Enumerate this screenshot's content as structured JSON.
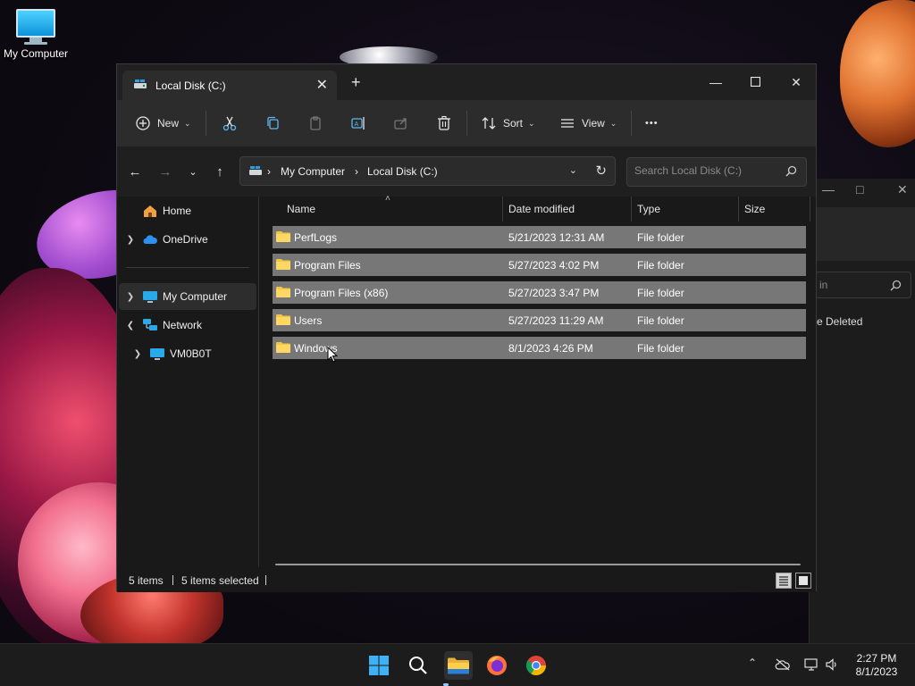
{
  "desktop": {
    "icon_label": "My Computer"
  },
  "background_window": {
    "search_placeholder": "in",
    "deleted_text": "e Deleted"
  },
  "window": {
    "tab_title": "Local Disk (C:)",
    "toolbar": {
      "new_label": "New",
      "sort_label": "Sort",
      "view_label": "View",
      "more_label": "•••"
    },
    "address": {
      "crumbs": [
        "My Computer",
        "Local Disk (C:)"
      ],
      "separator": "›"
    },
    "search_placeholder": "Search Local Disk (C:)",
    "nav_pane": {
      "items": [
        {
          "label": "Home"
        },
        {
          "label": "OneDrive"
        },
        {
          "label": "My Computer"
        },
        {
          "label": "Network"
        },
        {
          "label": "VM0B0T"
        }
      ]
    },
    "columns": [
      "Name",
      "Date modified",
      "Type",
      "Size"
    ],
    "rows": [
      {
        "name": "PerfLogs",
        "date": "5/21/2023 12:31 AM",
        "type": "File folder"
      },
      {
        "name": "Program Files",
        "date": "5/27/2023 4:02 PM",
        "type": "File folder"
      },
      {
        "name": "Program Files (x86)",
        "date": "5/27/2023 3:47 PM",
        "type": "File folder"
      },
      {
        "name": "Users",
        "date": "5/27/2023 11:29 AM",
        "type": "File folder"
      },
      {
        "name": "Windows",
        "date": "8/1/2023 4:26 PM",
        "type": "File folder"
      }
    ],
    "status": {
      "item_count": "5 items",
      "selected_count": "5 items selected"
    }
  },
  "taskbar": {
    "clock_time": "2:27 PM",
    "clock_date": "8/1/2023"
  },
  "colors": {
    "selection_row": "#777777",
    "accent": "#0b92d9",
    "folder": "#f3c744"
  }
}
